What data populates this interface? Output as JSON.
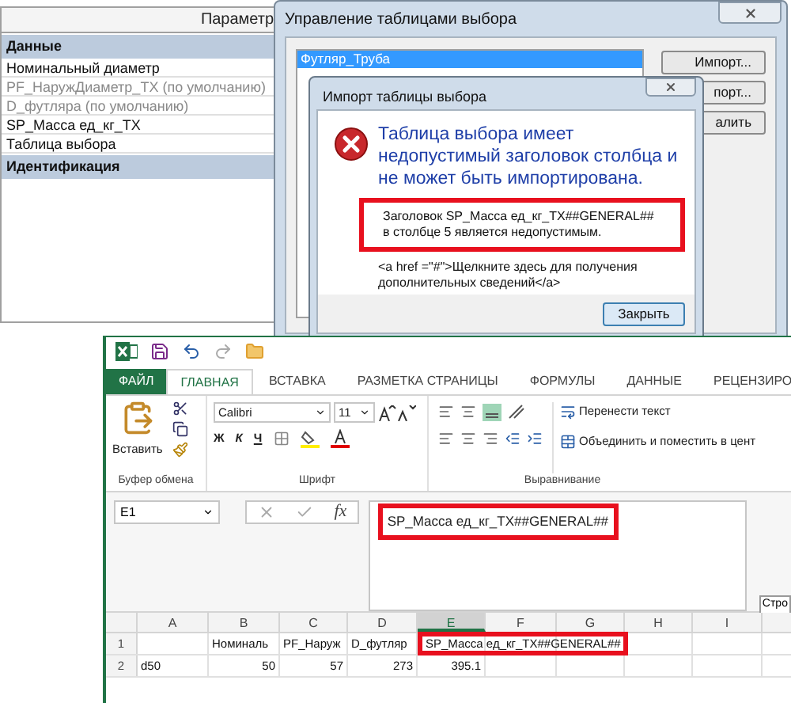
{
  "properties_panel": {
    "column_header": "Параметр",
    "rows": [
      {
        "kind": "group",
        "label": "Данные"
      },
      {
        "kind": "param",
        "label": "Номинальный диаметр",
        "disabled": false
      },
      {
        "kind": "param",
        "label": "PF_НаружДиаметр_TX (по умолчанию)",
        "disabled": true
      },
      {
        "kind": "param",
        "label": "D_футляра (по умолчанию)",
        "disabled": true
      },
      {
        "kind": "param",
        "label": "SP_Масса ед_кг_TX",
        "disabled": false
      },
      {
        "kind": "param",
        "label": "Таблица выбора",
        "disabled": false
      },
      {
        "kind": "group",
        "label": "Идентификация"
      }
    ]
  },
  "lookup_dialog": {
    "title": "Управление таблицами выбора",
    "tables": [
      {
        "label": "Футляр_Труба",
        "selected": true
      }
    ],
    "buttons": [
      "Импорт...",
      "порт...",
      "алить"
    ]
  },
  "import_dialog": {
    "title": "Импорт таблицы выбора",
    "heading": "Таблица выбора имеет недопустимый заголовок столбца и не может быть импортирована.",
    "error": "Заголовок SP_Масса ед_кг_TX##GENERAL## в столбце 5 является недопустимым.",
    "error_highlighted": true,
    "details": "<a href =\"#\">Щелкните здесь для получения дополнительных сведений</a>",
    "close_button": "Закрыть"
  },
  "excel": {
    "tabs": [
      {
        "label": "ФАЙЛ",
        "kind": "file",
        "selected": false
      },
      {
        "label": "ГЛАВНАЯ",
        "kind": "tab",
        "selected": true
      },
      {
        "label": "ВСТАВКА",
        "kind": "tab",
        "selected": false
      },
      {
        "label": "РАЗМЕТКА СТРАНИЦЫ",
        "kind": "tab",
        "selected": false
      },
      {
        "label": "ФОРМУЛЫ",
        "kind": "tab",
        "selected": false
      },
      {
        "label": "ДАННЫЕ",
        "kind": "tab",
        "selected": false
      },
      {
        "label": "РЕЦЕНЗИРО",
        "kind": "tab",
        "selected": false
      }
    ],
    "paste_button": "Вставить",
    "font_name": "Calibri",
    "font_size": "11",
    "bold": "Ж",
    "italic": "К",
    "underline": "Ч",
    "wrap_text": "Перенести текст",
    "merge_center": "Объединить и поместить в цент",
    "groups": [
      "Буфер обмена",
      "Шрифт",
      "Выравнивание"
    ],
    "name_box": "E1",
    "function_label": "fx",
    "formula": "SP_Масса ед_кг_TX##GENERAL##",
    "formula_highlighted": true,
    "columns": [
      {
        "label": "A",
        "selected": false
      },
      {
        "label": "B",
        "selected": false
      },
      {
        "label": "C",
        "selected": false
      },
      {
        "label": "D",
        "selected": false
      },
      {
        "label": "E",
        "selected": true
      },
      {
        "label": "F",
        "selected": false
      },
      {
        "label": "G",
        "selected": false
      },
      {
        "label": "H",
        "selected": false
      },
      {
        "label": "I",
        "selected": false
      }
    ],
    "rows": [
      {
        "header": "1",
        "cells": [
          "",
          "Номиналь",
          "PF_Наруж",
          "D_футляр",
          "SP_Масса ед_кг_TX##GENERAL##",
          "",
          "",
          "",
          ""
        ],
        "highlighted": true
      },
      {
        "header": "2",
        "cells": [
          "d50",
          "50",
          "57",
          "273",
          "395.1",
          "",
          "",
          "",
          ""
        ],
        "highlighted": false
      }
    ],
    "tooltip": "Стро"
  }
}
